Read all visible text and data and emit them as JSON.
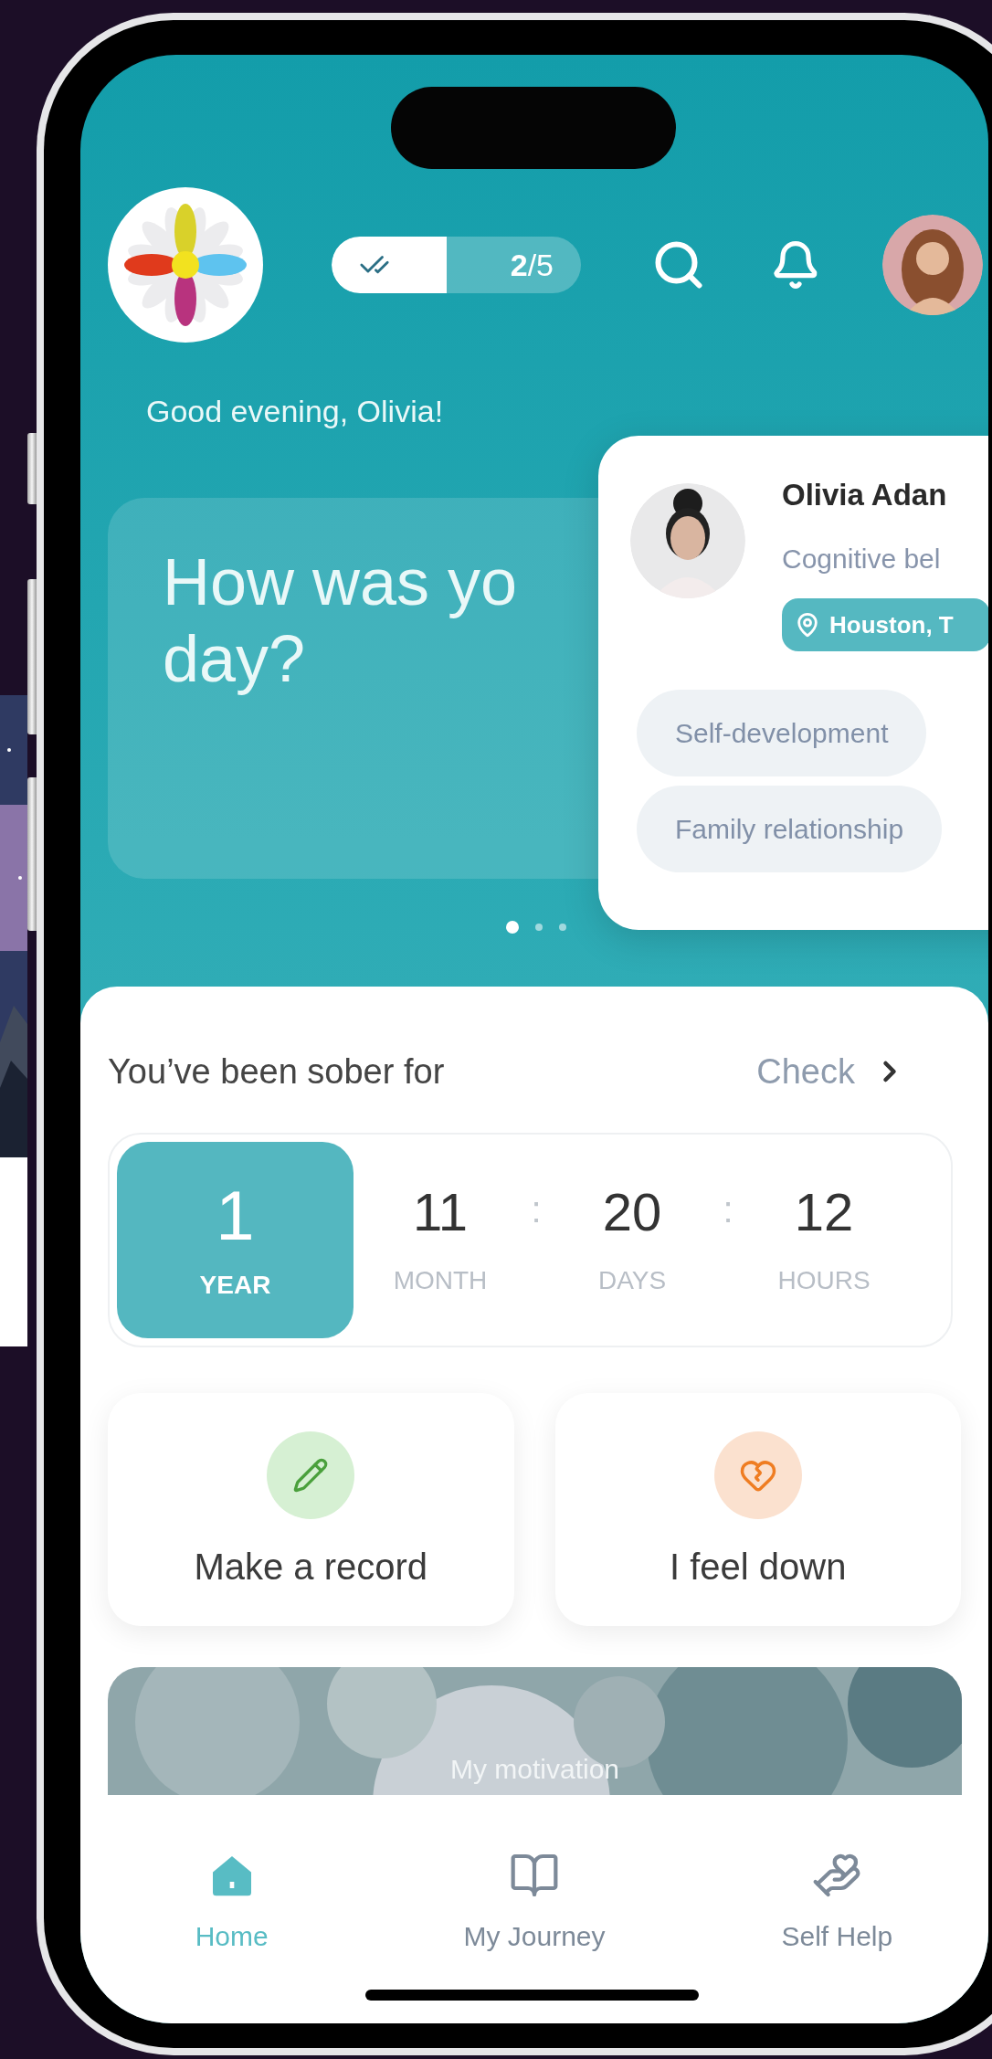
{
  "header": {
    "progress": {
      "text": "**2**/5",
      "level": 0.46
    }
  },
  "greeting": "Good evening, Olivia!",
  "prompt_card": {
    "lines": [
      "How was yo",
      "day?"
    ]
  },
  "carousel_dots": [
    {
      "selected": true
    },
    {
      "selected": false
    },
    {
      "selected": false
    }
  ],
  "profile_card": {
    "name": "Olivia Adan",
    "title": "Cognitive bel",
    "location": "Houston, T",
    "tags": [
      "Self-development",
      "Family relationship"
    ]
  },
  "sober": {
    "label": "You’ve been sober for",
    "link": "Check",
    "separator": ":",
    "units": [
      {
        "value": "1",
        "label": "YEAR",
        "highlighted": true
      },
      {
        "value": "11",
        "label": "MONTH",
        "highlighted": false
      },
      {
        "value": "20",
        "label": "DAYS",
        "highlighted": false
      },
      {
        "value": "12",
        "label": "HOURS",
        "highlighted": false
      }
    ]
  },
  "actions": [
    {
      "label": "Make a record",
      "kind": "record"
    },
    {
      "label": "I feel down",
      "kind": "down"
    }
  ],
  "motivation": {
    "label": "My motivation"
  },
  "nav": [
    {
      "label": "Home",
      "selected": true
    },
    {
      "label": "My Journey",
      "selected": false
    },
    {
      "label": "Self Help",
      "selected": false
    }
  ]
}
